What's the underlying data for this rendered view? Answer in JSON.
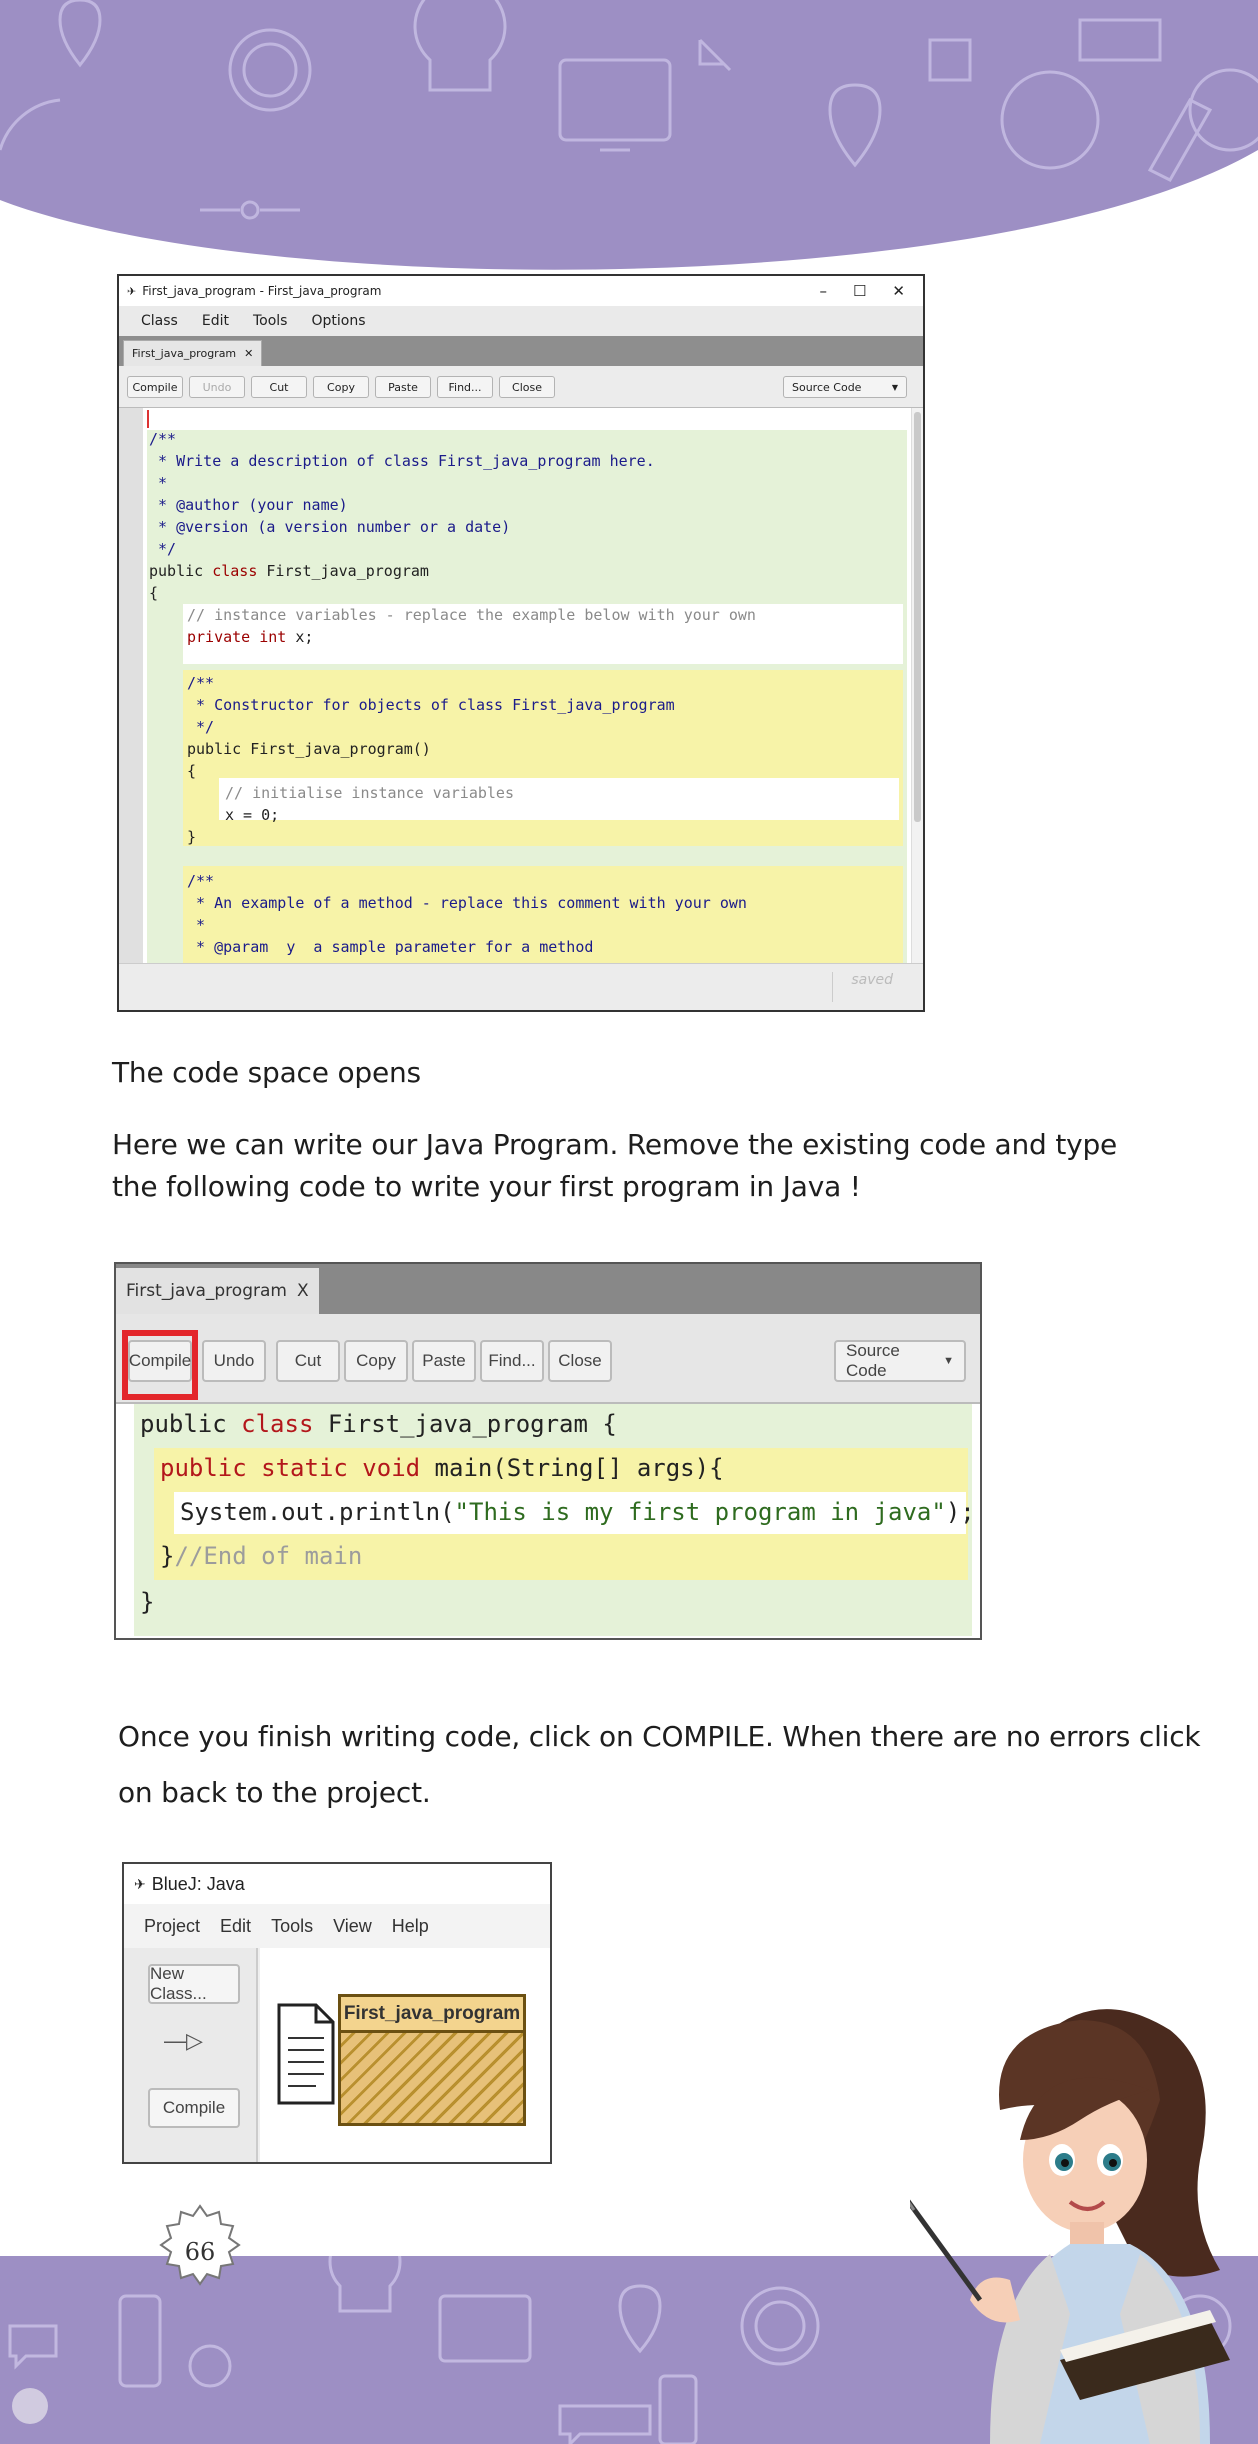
{
  "colors": {
    "band": "#9d8fc4",
    "highlight": "#e3262b",
    "class_green": "#e5f2d8",
    "method_yellow": "#f7f3a8"
  },
  "editor": {
    "window_title": "First_java_program - First_java_program",
    "window_buttons": [
      "–",
      "☐",
      "✕"
    ],
    "menu": [
      "Class",
      "Edit",
      "Tools",
      "Options"
    ],
    "tab_label": "First_java_program",
    "tab_close": "✕",
    "toolbar": [
      "Compile",
      "Undo",
      "Cut",
      "Copy",
      "Paste",
      "Find...",
      "Close"
    ],
    "view_select": "Source Code",
    "code": {
      "l1": "/**",
      "l2": " * Write a description of class First_java_program here.",
      "l3": " *",
      "l4": " * @author (your name)",
      "l5": " * @version (a version number or a date)",
      "l6": " */",
      "l7a": "public ",
      "l7b": "class",
      "l7c": " First_java_program",
      "l8": "{",
      "l9": "// instance variables - replace the example below with your own",
      "l10a": "private int",
      "l10b": " x;",
      "l11": "/**",
      "l12": " * Constructor for objects of class First_java_program",
      "l13": " */",
      "l14": "public First_java_program()",
      "l15": "{",
      "l16": "// initialise instance variables",
      "l17": "x = 0;",
      "l18": "}",
      "l19": "/**",
      "l20": " * An example of a method - replace this comment with your own",
      "l21": " *",
      "l22": " * @param  y  a sample parameter for a method"
    },
    "status": "saved"
  },
  "captions": {
    "c1": "The code space opens",
    "c2a": "Here we can write our Java Program. Remove the existing code and type",
    "c2b": "the following code to write your first program in Java !",
    "c3a": "Once you finish writing code, click on COMPILE. When there are no errors click",
    "c3b": "on back to the project."
  },
  "editor2": {
    "tab_label": "First_java_program",
    "tab_close": "X",
    "toolbar": [
      "Compile",
      "Undo",
      "Cut",
      "Copy",
      "Paste",
      "Find...",
      "Close"
    ],
    "view_select": "Source Code",
    "code": {
      "l1a": "public ",
      "l1b": "class",
      "l1c": " First_java_program {",
      "l2a": "public static ",
      "l2b": "void",
      "l2c": " main(String[] args){",
      "l3a": "System.out.println(",
      "l3b": "\"This is my first program in java\"",
      "l3c": ");",
      "l4a": "}",
      "l4b": "//End of main",
      "l5": "}"
    }
  },
  "project": {
    "window_title": "BlueJ: Java",
    "menu": [
      "Project",
      "Edit",
      "Tools",
      "View",
      "Help"
    ],
    "new_class": "New Class...",
    "arrow": "—▷",
    "compile": "Compile",
    "class_name": "First_java_program"
  },
  "page_number": "66"
}
